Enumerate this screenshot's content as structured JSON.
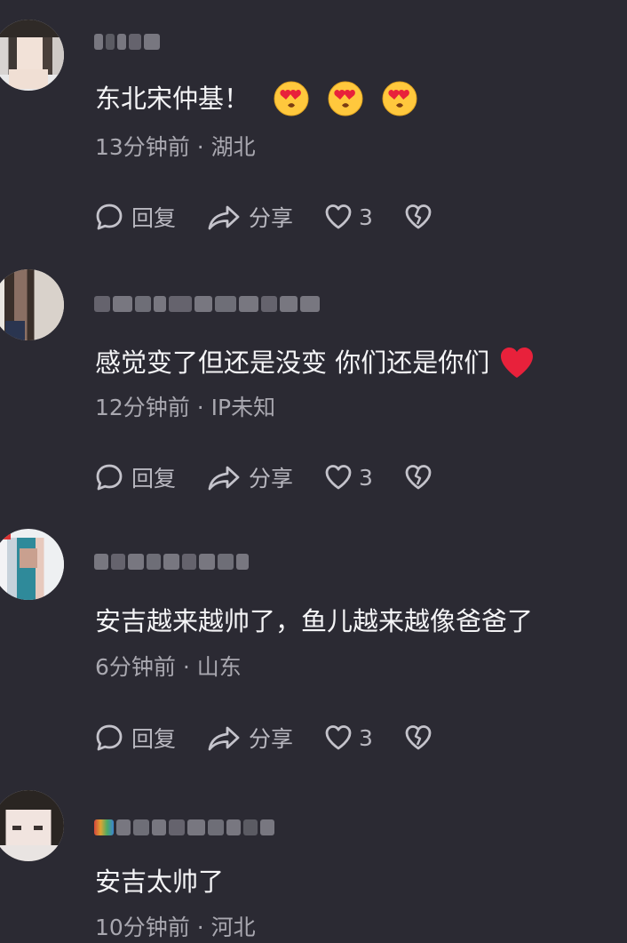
{
  "comments": [
    {
      "text": "东北宋仲基！",
      "time": "13分钟前",
      "location": "湖北",
      "reply": "回复",
      "share": "分享",
      "likes": "3",
      "suffix_icons": [
        "heart-eyes-emoji",
        "heart-eyes-emoji",
        "heart-eyes-emoji"
      ]
    },
    {
      "text": "感觉变了但还是没变 你们还是你们",
      "time": "12分钟前",
      "location": "IP未知",
      "reply": "回复",
      "share": "分享",
      "likes": "3",
      "suffix_icons": [
        "red-heart-emoji"
      ]
    },
    {
      "text": "安吉越来越帅了，鱼儿越来越像爸爸了",
      "time": "6分钟前",
      "location": "山东",
      "reply": "回复",
      "share": "分享",
      "likes": "3",
      "suffix_icons": []
    },
    {
      "text": "安吉太帅了",
      "time": "10分钟前",
      "location": "河北",
      "suffix_icons": []
    }
  ],
  "meta_separator": " · ",
  "colors": {
    "background": "#2b2a33",
    "text": "#f4f4f6",
    "meta": "#a9a8b0",
    "heart": "#e8213b",
    "emoji_face": "#ffc83d"
  }
}
